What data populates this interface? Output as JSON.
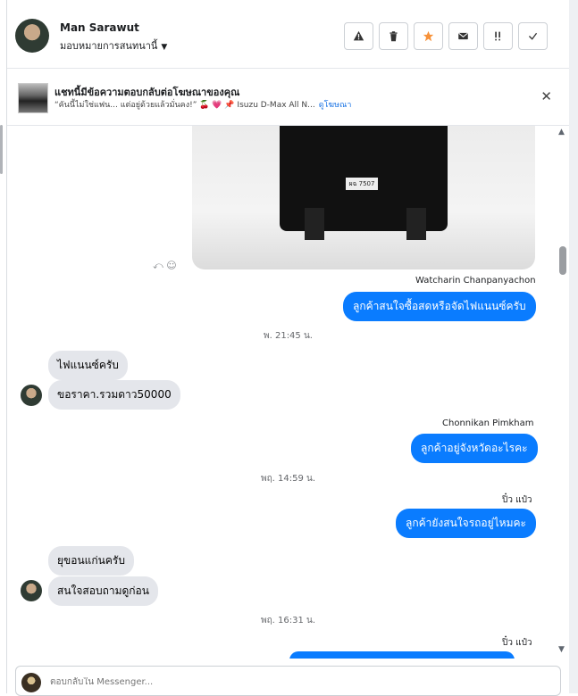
{
  "header": {
    "contact_name": "Man Sarawut",
    "assign_label": "มอบหมายการสนทนานี้",
    "actions": [
      {
        "name": "report-spam-button",
        "icon": "warning-icon"
      },
      {
        "name": "delete-button",
        "icon": "trash-icon"
      },
      {
        "name": "star-button",
        "icon": "star-icon"
      },
      {
        "name": "mark-unread-button",
        "icon": "envelope-icon"
      },
      {
        "name": "follow-up-button",
        "icon": "flag-icon"
      },
      {
        "name": "mark-done-button",
        "icon": "check-icon"
      }
    ]
  },
  "banner": {
    "title": "แชทนี้มีข้อความตอบกลับต่อโฆษณาของคุณ",
    "subtitle": "“คันนี้ไม่ใช่แฟน... แต่อยู่ด้วยแล้วมั่นคง!” 🍒 💗 📌 Isuzu D-Max All N...",
    "link": "ดูโฆษณา"
  },
  "chat": {
    "plate_text": "ผฉ 7507",
    "messages": [
      {
        "sender": "Watcharin Chanpanyachon",
        "text": "ลูกค้าสนใจซื้อสดหรือจัดไฟแนนซ์ครับ"
      },
      {
        "timestamp": "พ. 21:45 น."
      },
      {
        "text": "ไฟแนนซ์ครับ"
      },
      {
        "text": "ขอราคา.รวมดาว50000"
      },
      {
        "sender": "Chonnikan Pimkham",
        "text": "ลูกค้าอยู่จังหวัดอะไรคะ"
      },
      {
        "timestamp": "พฤ. 14:59 น."
      },
      {
        "sender": "ปิ๋ว แป๋ว",
        "text": "ลูกค้ายังสนใจรถอยู่ไหมคะ"
      },
      {
        "text": "ยุขอนแก่นครับ"
      },
      {
        "text": "สนใจสอบถามดูก่อน"
      },
      {
        "timestamp": "พฤ. 16:31 น."
      },
      {
        "sender": "ปิ๋ว แป๋ว"
      }
    ]
  },
  "composer": {
    "placeholder": "ตอบกลับใน Messenger..."
  },
  "colors": {
    "accent": "#0a7cff",
    "incoming_bubble": "#e4e6eb",
    "star": "#f7923a"
  }
}
